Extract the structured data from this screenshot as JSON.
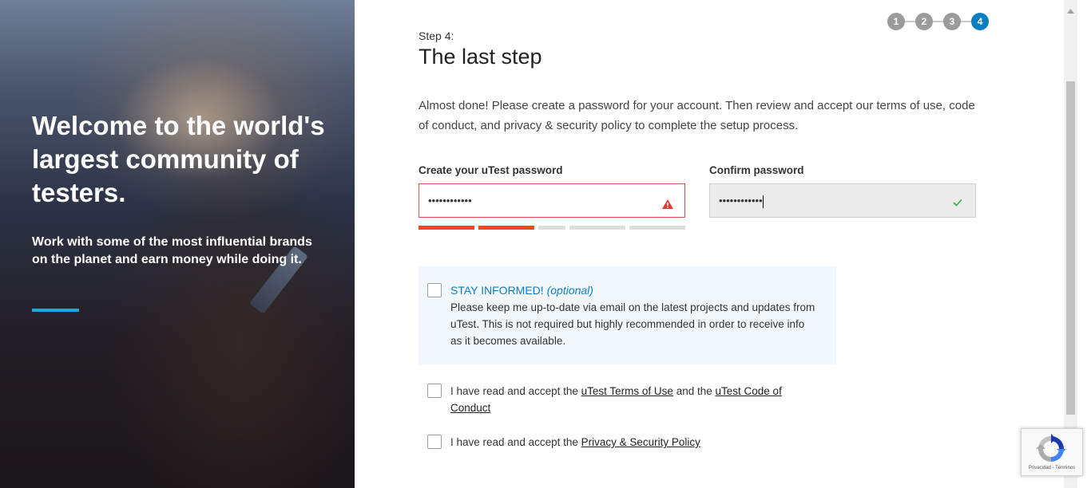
{
  "hero": {
    "title": "Welcome to the world's largest community of testers.",
    "subtitle": "Work with some of the most influential brands on the planet and earn money while doing it."
  },
  "stepper": {
    "steps": [
      "1",
      "2",
      "3",
      "4"
    ],
    "active_step": 4,
    "done_color": "#9b9b9b",
    "active_color": "#0b7ec2"
  },
  "form": {
    "step_label": "Step 4:",
    "title": "The last step",
    "intro": "Almost done! Please create a password for your account. Then review and accept our terms of use, code of conduct, and privacy & security policy to complete the setup process.",
    "password": {
      "label": "Create your uTest password",
      "value": "••••••••••••",
      "status": "error",
      "strength_filled_segments": 2,
      "strength_total_segments": 5,
      "strength_color": "#fa4616"
    },
    "confirm": {
      "label": "Confirm password",
      "value": "••••••••••••",
      "status": "valid"
    }
  },
  "optin": {
    "heading": "STAY INFORMED!",
    "optional": "(optional)",
    "text": "Please keep me up-to-date via email on the latest projects and updates from uTest. This is not required but highly recommended in order to receive info as it becomes available.",
    "checked": false
  },
  "terms": {
    "prefix": "I have read and accept the",
    "link_terms": "uTest Terms of Use",
    "middle": "and the",
    "link_code": "uTest Code of Conduct",
    "checked": false
  },
  "privacy": {
    "prefix": "I have read and accept the",
    "link": "Privacy & Security Policy",
    "checked": false
  },
  "recaptcha": {
    "text": "Privacidad - Términos"
  }
}
